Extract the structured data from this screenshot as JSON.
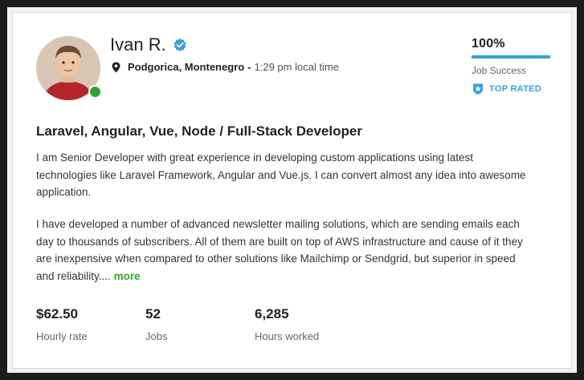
{
  "profile": {
    "name": "Ivan R.",
    "verified_icon": "verified-badge-icon",
    "location_icon": "map-pin-icon",
    "city": "Podgorica, Montenegro",
    "separator": "-",
    "local_time": "1:29 pm local time",
    "online": true
  },
  "job_success": {
    "percent_text": "100%",
    "percent_value": 100,
    "label": "Job Success",
    "badge_label": "TOP RATED",
    "badge_icon": "top-rated-shield-icon"
  },
  "headline": "Laravel, Angular, Vue, Node / Full-Stack Developer",
  "description": {
    "paragraph1": "I am Senior Developer with great experience in developing custom applications using latest technologies like Laravel Framework, Angular and Vue.js. I can convert almost any idea into awesome application.",
    "paragraph2": "I have developed a number of advanced newsletter mailing solutions, which are sending emails each day to thousands of subscribers. All of them are built on top of AWS infrastructure and cause of it they are inexpensive when compared to other solutions like Mailchimp or Sendgrid, but superior in speed and reliability....",
    "more_label": "more"
  },
  "stats": {
    "hourly_rate": {
      "value": "$62.50",
      "label": "Hourly rate"
    },
    "jobs": {
      "value": "52",
      "label": "Jobs"
    },
    "hours": {
      "value": "6,285",
      "label": "Hours worked"
    }
  },
  "colors": {
    "accent_blue": "#37a0e0",
    "online_green": "#2fa52f",
    "link_green": "#2fa52f"
  }
}
